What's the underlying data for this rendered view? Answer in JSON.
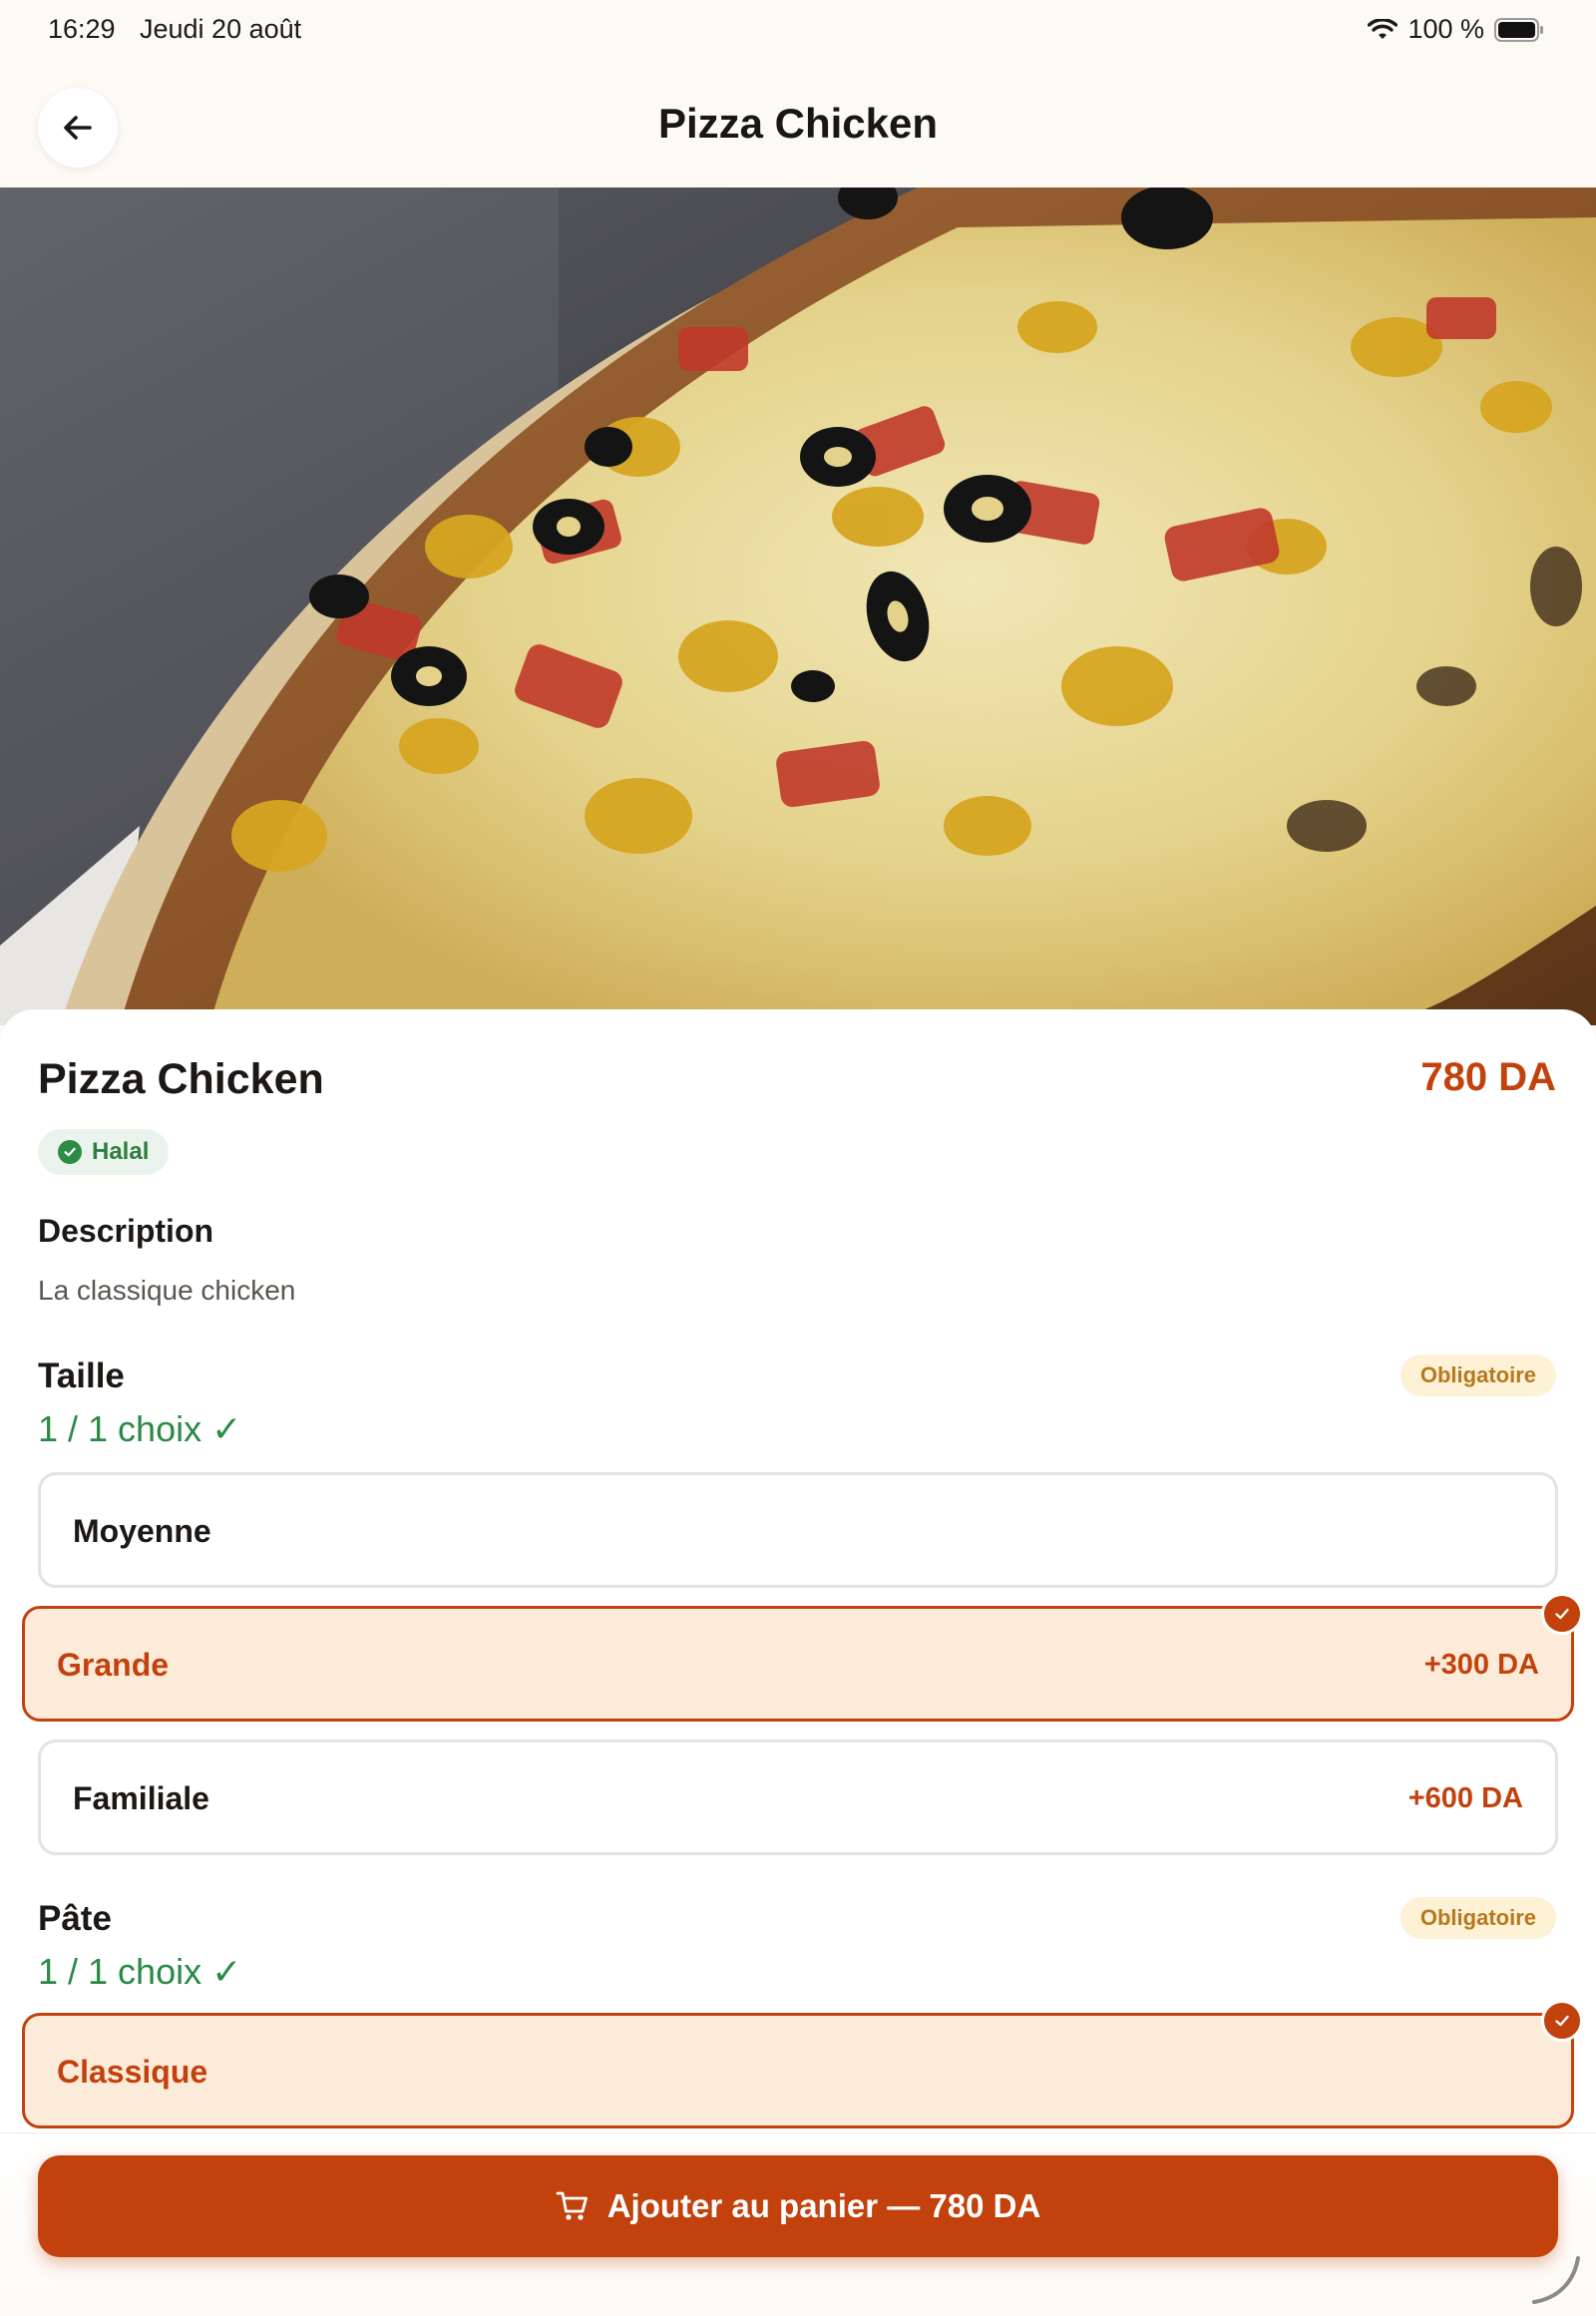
{
  "status_bar": {
    "time": "16:29",
    "date": "Jeudi 20 août",
    "battery": "100 %",
    "icons": [
      "wifi-icon",
      "battery-icon"
    ]
  },
  "header": {
    "title": "Pizza Chicken",
    "back_icon": "arrow-left-icon"
  },
  "hero_image": {
    "subject": "pizza-chicken-photo"
  },
  "product": {
    "name": "Pizza Chicken",
    "price": "780 DA",
    "badge": "Halal",
    "description_title": "Description",
    "description": "La classique chicken"
  },
  "sections": [
    {
      "title": "Taille",
      "count": "1 / 1 choix ✓",
      "required": "Obligatoire",
      "options": [
        {
          "label": "Moyenne",
          "price": "",
          "selected": false
        },
        {
          "label": "Grande",
          "price": "+300 DA",
          "selected": true
        },
        {
          "label": "Familiale",
          "price": "+600 DA",
          "selected": false
        }
      ]
    },
    {
      "title": "Pâte",
      "count": "1 / 1 choix ✓",
      "required": "Obligatoire",
      "options": [
        {
          "label": "Classique",
          "price": "",
          "selected": true
        }
      ]
    }
  ],
  "cart_button": {
    "label": "Ajouter au panier — 780 DA",
    "icon": "cart-icon"
  },
  "colors": {
    "accent": "#c2410c",
    "selected_bg": "#fdebd9",
    "success": "#2a8a45",
    "required_bg": "#fdf1d6",
    "required_text": "#b7791f"
  }
}
